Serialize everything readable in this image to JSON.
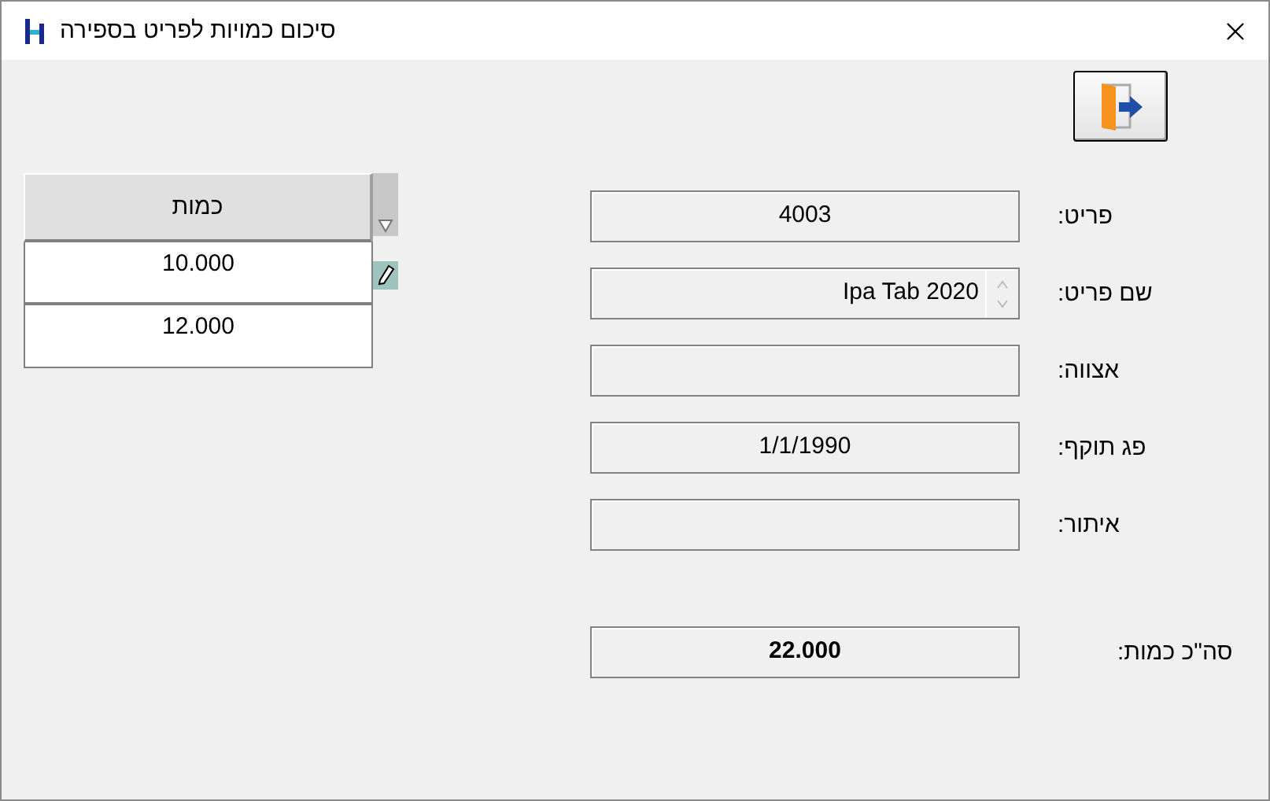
{
  "window": {
    "title": "סיכום כמויות לפריט בספירה"
  },
  "grid": {
    "column": "כמות",
    "rows": [
      "10.000",
      "12.000"
    ]
  },
  "fields": [
    {
      "label": "פריט:",
      "value": "4003",
      "kind": "text"
    },
    {
      "label": "שם פריט:",
      "value": "Ipa Tab 2020",
      "kind": "spin"
    },
    {
      "label": "אצווה:",
      "kind": "text"
    },
    {
      "label": "פג תוקף:",
      "value": "1/1/1990",
      "kind": "text"
    },
    {
      "label": "איתור:",
      "kind": "text"
    },
    {
      "label": "סה\"כ כמות:",
      "value": "22.000",
      "kind": "total"
    }
  ]
}
